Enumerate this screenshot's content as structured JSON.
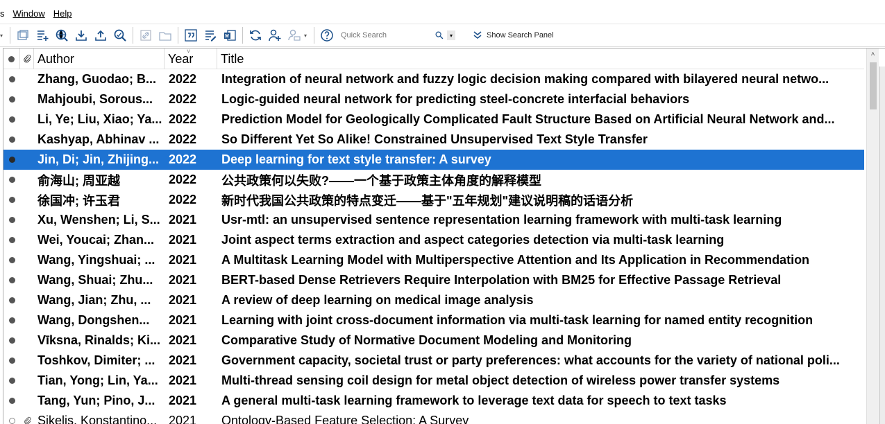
{
  "menu": {
    "items": [
      "s",
      "Window",
      "Help"
    ]
  },
  "search": {
    "placeholder": "Quick Search",
    "show_panel_label": "Show Search Panel"
  },
  "columns": {
    "author": "Author",
    "year": "Year",
    "title": "Title"
  },
  "colors": {
    "selection": "#1e73d2",
    "accent": "#1a5fb4"
  },
  "rows": [
    {
      "author": "Zhang, Guodao; B...",
      "year": "2022",
      "title": "Integration of neural network and fuzzy logic decision making compared with bilayered neural netwo...",
      "selected": false
    },
    {
      "author": "Mahjoubi, Sorous...",
      "year": "2022",
      "title": "Logic-guided neural network for predicting steel-concrete interfacial behaviors",
      "selected": false
    },
    {
      "author": "Li, Ye; Liu, Xiao; Ya...",
      "year": "2022",
      "title": "Prediction Model for Geologically Complicated Fault Structure Based on Artificial Neural Network and...",
      "selected": false
    },
    {
      "author": "Kashyap, Abhinav ...",
      "year": "2022",
      "title": "So Different Yet So Alike! Constrained Unsupervised Text Style Transfer",
      "selected": false
    },
    {
      "author": "Jin, Di; Jin, Zhijing...",
      "year": "2022",
      "title": "Deep learning for text style transfer: A survey",
      "selected": true
    },
    {
      "author": "俞海山; 周亚越",
      "year": "2022",
      "title": "公共政策何以失败?——一个基于政策主体角度的解释模型",
      "selected": false
    },
    {
      "author": "徐国冲; 许玉君",
      "year": "2022",
      "title": "新时代我国公共政策的特点变迁——基于\"五年规划\"建议说明稿的话语分析",
      "selected": false
    },
    {
      "author": "Xu, Wenshen; Li, S...",
      "year": "2021",
      "title": "Usr-mtl: an unsupervised sentence representation learning framework with multi-task learning",
      "selected": false
    },
    {
      "author": "Wei, Youcai; Zhan...",
      "year": "2021",
      "title": "Joint aspect terms extraction and aspect categories detection via multi-task learning",
      "selected": false
    },
    {
      "author": "Wang, Yingshuai; ...",
      "year": "2021",
      "title": "A Multitask Learning Model with Multiperspective Attention and Its Application in Recommendation",
      "selected": false
    },
    {
      "author": "Wang, Shuai; Zhu...",
      "year": "2021",
      "title": "BERT-based Dense Retrievers Require Interpolation with BM25 for Effective Passage Retrieval",
      "selected": false
    },
    {
      "author": "Wang, Jian; Zhu, ...",
      "year": "2021",
      "title": "A review of deep learning on medical image analysis",
      "selected": false
    },
    {
      "author": "Wang, Dongshen...",
      "year": "2021",
      "title": "Learning with joint cross-document information via multi-task learning for named entity recognition",
      "selected": false
    },
    {
      "author": "Vīksna, Rinalds; Ki...",
      "year": "2021",
      "title": "Comparative Study of Normative Document Modeling and Monitoring",
      "selected": false
    },
    {
      "author": "Toshkov, Dimiter; ...",
      "year": "2021",
      "title": "Government capacity, societal trust or party preferences: what accounts for the variety of national poli...",
      "selected": false
    },
    {
      "author": "Tian, Yong; Lin, Ya...",
      "year": "2021",
      "title": "Multi-thread sensing coil design for metal object detection of wireless power transfer systems",
      "selected": false
    },
    {
      "author": "Tang, Yun; Pino, J...",
      "year": "2021",
      "title": "A general multi-task learning framework to leverage text data for speech to text tasks",
      "selected": false
    },
    {
      "author": "Sikelis, Konstantino...",
      "year": "2021",
      "title": "Ontology-Based Feature Selection: A Survey",
      "selected": false,
      "read": true,
      "attachment": true
    }
  ]
}
